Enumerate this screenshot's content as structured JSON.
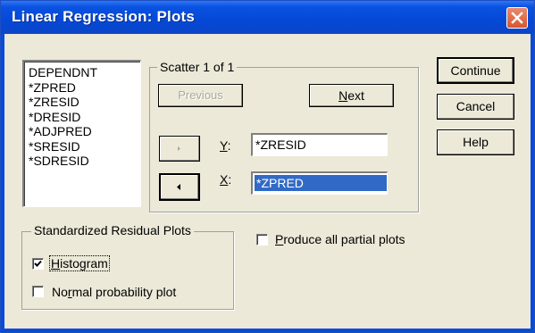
{
  "window": {
    "title": "Linear Regression: Plots"
  },
  "variables": [
    "DEPENDNT",
    "*ZPRED",
    "*ZRESID",
    "*DRESID",
    "*ADJPRED",
    "*SRESID",
    "*SDRESID"
  ],
  "scatter": {
    "group_label": "Scatter 1 of 1",
    "previous_label": "Previous",
    "next_label": "Next",
    "y_label": "Y:",
    "y_value": "*ZRESID",
    "x_label": "X:",
    "x_value": "*ZPRED"
  },
  "buttons": {
    "continue": "Continue",
    "cancel": "Cancel",
    "help": "Help"
  },
  "residuals": {
    "group_label": "Standardized Residual Plots",
    "histogram_label": "Histogram",
    "histogram_checked": true,
    "normal_label": "Normal probability plot",
    "normal_checked": false
  },
  "partial": {
    "label": "Produce all partial plots",
    "checked": false
  }
}
